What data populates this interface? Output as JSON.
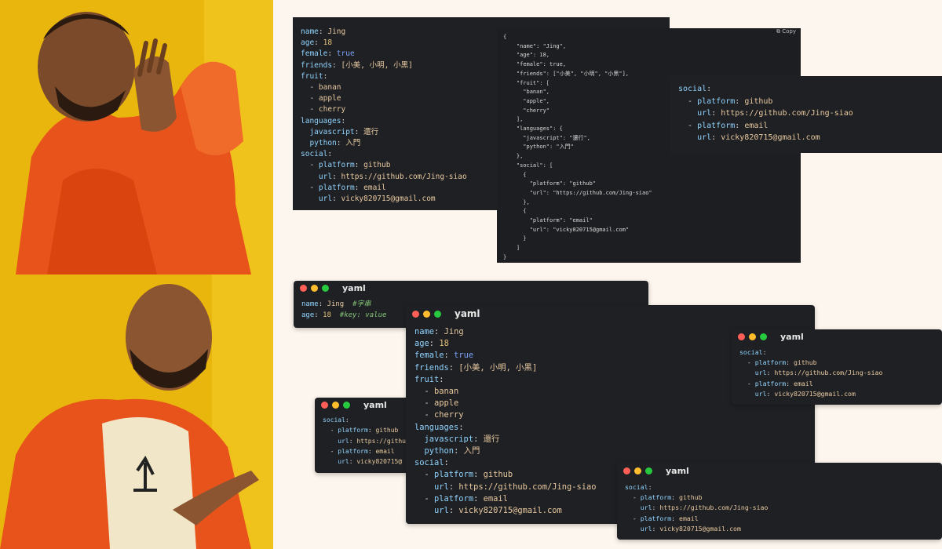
{
  "yaml_full": [
    [
      "name",
      "Jing"
    ],
    [
      "age",
      "18"
    ],
    [
      "female",
      "true"
    ],
    [
      "friends",
      "[小美, 小明, 小黑]"
    ],
    [
      "fruit",
      ""
    ],
    [
      "-",
      "banan"
    ],
    [
      "-",
      "apple"
    ],
    [
      "-",
      "cherry"
    ],
    [
      "languages",
      ""
    ],
    [
      "javascript",
      "還行"
    ],
    [
      "python",
      "入門"
    ],
    [
      "social",
      ""
    ],
    [
      "- platform",
      "github"
    ],
    [
      "url",
      "https://github.com/Jing-siao"
    ],
    [
      "- platform",
      "email"
    ],
    [
      "url",
      "vicky820715@gmail.com"
    ]
  ],
  "json_text": "{\n    \"name\": \"Jing\",\n    \"age\": 18,\n    \"female\": true,\n    \"friends\": [\"小美\", \"小明\", \"小黑\"],\n    \"fruit\": [\n      \"banan\",\n      \"apple\",\n      \"cherry\"\n    ],\n    \"languages\": {\n      \"javascript\": \"還行\",\n      \"python\": \"入門\"\n    },\n    \"social\": [\n      {\n        \"platform\": \"github\"\n        \"url\": \"https://github.com/Jing-siao\"\n      },\n      {\n        \"platform\": \"email\"\n        \"url\": \"vicky820715@gmail.com\"\n      }\n    ]\n}",
  "copy_label": "Copy",
  "window_title": "yaml",
  "social": {
    "key": "social",
    "platform_key": "platform",
    "url_key": "url",
    "github": "github",
    "github_url": "https://github.com/Jing-siao",
    "email": "email",
    "email_url": "vicky820715@gmail.com",
    "truncated_url": "https://githu",
    "truncated_email": "vicky820715@"
  },
  "comments": {
    "name_value": "Jing",
    "name_comment": "#字串",
    "age_value": "18",
    "age_comment": "#key: value"
  }
}
